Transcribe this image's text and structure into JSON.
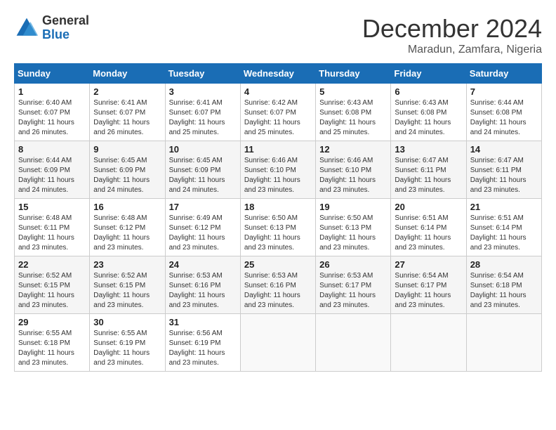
{
  "header": {
    "logo_line1": "General",
    "logo_line2": "Blue",
    "month": "December 2024",
    "location": "Maradun, Zamfara, Nigeria"
  },
  "days_of_week": [
    "Sunday",
    "Monday",
    "Tuesday",
    "Wednesday",
    "Thursday",
    "Friday",
    "Saturday"
  ],
  "weeks": [
    [
      {
        "day": 1,
        "sunrise": "6:40 AM",
        "sunset": "6:07 PM",
        "daylight": "11 hours and 26 minutes."
      },
      {
        "day": 2,
        "sunrise": "6:41 AM",
        "sunset": "6:07 PM",
        "daylight": "11 hours and 26 minutes."
      },
      {
        "day": 3,
        "sunrise": "6:41 AM",
        "sunset": "6:07 PM",
        "daylight": "11 hours and 25 minutes."
      },
      {
        "day": 4,
        "sunrise": "6:42 AM",
        "sunset": "6:07 PM",
        "daylight": "11 hours and 25 minutes."
      },
      {
        "day": 5,
        "sunrise": "6:43 AM",
        "sunset": "6:08 PM",
        "daylight": "11 hours and 25 minutes."
      },
      {
        "day": 6,
        "sunrise": "6:43 AM",
        "sunset": "6:08 PM",
        "daylight": "11 hours and 24 minutes."
      },
      {
        "day": 7,
        "sunrise": "6:44 AM",
        "sunset": "6:08 PM",
        "daylight": "11 hours and 24 minutes."
      }
    ],
    [
      {
        "day": 8,
        "sunrise": "6:44 AM",
        "sunset": "6:09 PM",
        "daylight": "11 hours and 24 minutes."
      },
      {
        "day": 9,
        "sunrise": "6:45 AM",
        "sunset": "6:09 PM",
        "daylight": "11 hours and 24 minutes."
      },
      {
        "day": 10,
        "sunrise": "6:45 AM",
        "sunset": "6:09 PM",
        "daylight": "11 hours and 24 minutes."
      },
      {
        "day": 11,
        "sunrise": "6:46 AM",
        "sunset": "6:10 PM",
        "daylight": "11 hours and 23 minutes."
      },
      {
        "day": 12,
        "sunrise": "6:46 AM",
        "sunset": "6:10 PM",
        "daylight": "11 hours and 23 minutes."
      },
      {
        "day": 13,
        "sunrise": "6:47 AM",
        "sunset": "6:11 PM",
        "daylight": "11 hours and 23 minutes."
      },
      {
        "day": 14,
        "sunrise": "6:47 AM",
        "sunset": "6:11 PM",
        "daylight": "11 hours and 23 minutes."
      }
    ],
    [
      {
        "day": 15,
        "sunrise": "6:48 AM",
        "sunset": "6:11 PM",
        "daylight": "11 hours and 23 minutes."
      },
      {
        "day": 16,
        "sunrise": "6:48 AM",
        "sunset": "6:12 PM",
        "daylight": "11 hours and 23 minutes."
      },
      {
        "day": 17,
        "sunrise": "6:49 AM",
        "sunset": "6:12 PM",
        "daylight": "11 hours and 23 minutes."
      },
      {
        "day": 18,
        "sunrise": "6:50 AM",
        "sunset": "6:13 PM",
        "daylight": "11 hours and 23 minutes."
      },
      {
        "day": 19,
        "sunrise": "6:50 AM",
        "sunset": "6:13 PM",
        "daylight": "11 hours and 23 minutes."
      },
      {
        "day": 20,
        "sunrise": "6:51 AM",
        "sunset": "6:14 PM",
        "daylight": "11 hours and 23 minutes."
      },
      {
        "day": 21,
        "sunrise": "6:51 AM",
        "sunset": "6:14 PM",
        "daylight": "11 hours and 23 minutes."
      }
    ],
    [
      {
        "day": 22,
        "sunrise": "6:52 AM",
        "sunset": "6:15 PM",
        "daylight": "11 hours and 23 minutes."
      },
      {
        "day": 23,
        "sunrise": "6:52 AM",
        "sunset": "6:15 PM",
        "daylight": "11 hours and 23 minutes."
      },
      {
        "day": 24,
        "sunrise": "6:53 AM",
        "sunset": "6:16 PM",
        "daylight": "11 hours and 23 minutes."
      },
      {
        "day": 25,
        "sunrise": "6:53 AM",
        "sunset": "6:16 PM",
        "daylight": "11 hours and 23 minutes."
      },
      {
        "day": 26,
        "sunrise": "6:53 AM",
        "sunset": "6:17 PM",
        "daylight": "11 hours and 23 minutes."
      },
      {
        "day": 27,
        "sunrise": "6:54 AM",
        "sunset": "6:17 PM",
        "daylight": "11 hours and 23 minutes."
      },
      {
        "day": 28,
        "sunrise": "6:54 AM",
        "sunset": "6:18 PM",
        "daylight": "11 hours and 23 minutes."
      }
    ],
    [
      {
        "day": 29,
        "sunrise": "6:55 AM",
        "sunset": "6:18 PM",
        "daylight": "11 hours and 23 minutes."
      },
      {
        "day": 30,
        "sunrise": "6:55 AM",
        "sunset": "6:19 PM",
        "daylight": "11 hours and 23 minutes."
      },
      {
        "day": 31,
        "sunrise": "6:56 AM",
        "sunset": "6:19 PM",
        "daylight": "11 hours and 23 minutes."
      },
      null,
      null,
      null,
      null
    ]
  ]
}
